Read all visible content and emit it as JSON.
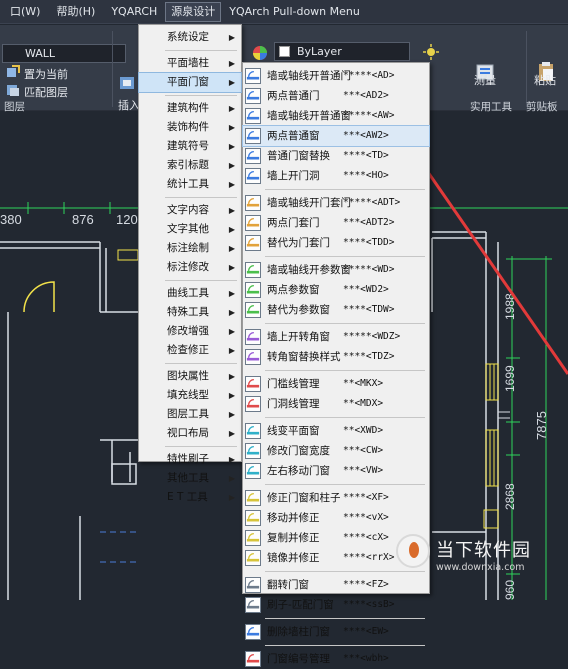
{
  "menubar": {
    "items": [
      "口(W)",
      "帮助(H)",
      "YQARCH",
      "源泉设计",
      "YQArch Pull-down Menu"
    ],
    "active_index": 3
  },
  "ribbon": {
    "layer_select": "WALL",
    "set_current": "置为当前",
    "match_layer": "匹配图层",
    "layer_group": "图层",
    "insert": "插入",
    "bylayer": "ByLayer",
    "measure": "测量",
    "paste": "粘贴",
    "utilities_group": "实用工具",
    "clipboard_group": "剪贴板"
  },
  "main_menu": {
    "groups": [
      [
        "系统设定"
      ],
      [
        "平面墙柱",
        "平面门窗"
      ],
      [
        "建筑构件",
        "装饰构件",
        "建筑符号",
        "索引标题",
        "统计工具"
      ],
      [
        "文字内容",
        "文字其他",
        "标注绘制",
        "标注修改"
      ],
      [
        "曲线工具",
        "特殊工具",
        "修改增强",
        "检查修正"
      ],
      [
        "图块属性",
        "填充线型",
        "图层工具",
        "视口布局"
      ],
      [
        "特性刷子",
        "其他工具",
        "E T 工具"
      ]
    ],
    "active": "平面门窗"
  },
  "submenu": {
    "groups": [
      [
        {
          "label": "墙或轴线开普通门",
          "cmd": "*****<AD>"
        },
        {
          "label": "两点普通门",
          "cmd": "***<AD2>"
        },
        {
          "label": "墙或轴线开普通窗",
          "cmd": "*****<AW>"
        },
        {
          "label": "两点普通窗",
          "cmd": "***<AW2>"
        },
        {
          "label": "普通门窗替换",
          "cmd": "****<TD>"
        },
        {
          "label": "墙上开门洞",
          "cmd": "****<HO>"
        }
      ],
      [
        {
          "label": "墙或轴线开门套门",
          "cmd": "*****<ADT>"
        },
        {
          "label": "两点门套门",
          "cmd": "***<ADT2>"
        },
        {
          "label": "替代为门套门",
          "cmd": "****<TDD>"
        }
      ],
      [
        {
          "label": "墙或轴线开参数窗",
          "cmd": "*****<WD>"
        },
        {
          "label": "两点参数窗",
          "cmd": "***<WD2>"
        },
        {
          "label": "替代为参数窗",
          "cmd": "****<TDW>"
        }
      ],
      [
        {
          "label": "墙上开转角窗",
          "cmd": "*****<WDZ>"
        },
        {
          "label": "转角窗替换样式",
          "cmd": "****<TDZ>"
        }
      ],
      [
        {
          "label": "门槛线管理",
          "cmd": "**<MKX>"
        },
        {
          "label": "门洞线管理",
          "cmd": "**<MDX>"
        }
      ],
      [
        {
          "label": "线变平面窗",
          "cmd": "**<XWD>"
        },
        {
          "label": "修改门窗宽度",
          "cmd": "***<CW>"
        },
        {
          "label": "左右移动门窗",
          "cmd": "***<VW>"
        }
      ],
      [
        {
          "label": "修正门窗和柱子",
          "cmd": "****<XF>"
        },
        {
          "label": "移动并修正",
          "cmd": "****<vX>"
        },
        {
          "label": "复制并修正",
          "cmd": "****<cX>"
        },
        {
          "label": "镜像并修正",
          "cmd": "****<rrX>"
        }
      ],
      [
        {
          "label": "翻转门窗",
          "cmd": "****<FZ>"
        },
        {
          "label": "刷子-匹配门窗",
          "cmd": "****<ssB>"
        }
      ],
      [
        {
          "label": "删除墙柱门窗",
          "cmd": "****<EW>"
        }
      ],
      [
        {
          "label": "门窗编号管理",
          "cmd": "***<wbh>"
        }
      ]
    ],
    "highlighted": "两点普通窗"
  },
  "drawing": {
    "dims_top": [
      "380",
      "876",
      "120"
    ],
    "dims_right": [
      "1988",
      "1699",
      "7875",
      "2868",
      "960"
    ]
  },
  "watermark": {
    "title": "当下软件园",
    "url": "www.downxia.com"
  },
  "colors": {
    "arrow": "#e23a3a",
    "dimension": "#2fd35a",
    "wall": "#d8dde4",
    "window": "#f2e24a"
  }
}
